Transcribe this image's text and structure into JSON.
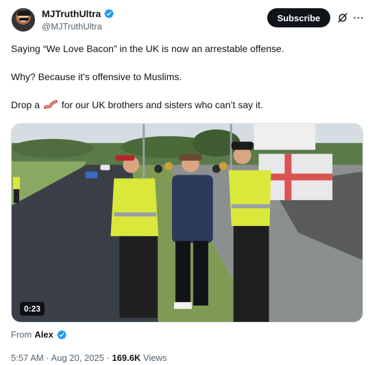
{
  "author": {
    "display_name": "MJTruthUltra",
    "handle": "@MJTruthUltra"
  },
  "header": {
    "subscribe_label": "Subscribe"
  },
  "text": {
    "line1": "Saying “We Love Bacon” in the UK is now an arrestable offense.",
    "line2": "Why? Because it’s offensive to Muslims.",
    "line3_before": "Drop a",
    "line3_after": "for our UK brothers and sisters who can’t say it."
  },
  "media": {
    "duration": "0:23"
  },
  "from": {
    "label": "From",
    "name": "Alex"
  },
  "meta": {
    "time": "5:57 AM",
    "separator1": " · ",
    "date": "Aug 20, 2025",
    "separator2": " · ",
    "views_count": "169.6K",
    "views_label": " Views"
  },
  "colors": {
    "verified": "#1d9bf0",
    "text": "#0f1419",
    "secondary": "#536471",
    "subscribe_bg": "#0f1419"
  },
  "icons": {
    "verified": "verified-badge-icon",
    "grok": "grok-icon",
    "more": "more-icon",
    "bacon": "bacon-emoji-icon"
  }
}
